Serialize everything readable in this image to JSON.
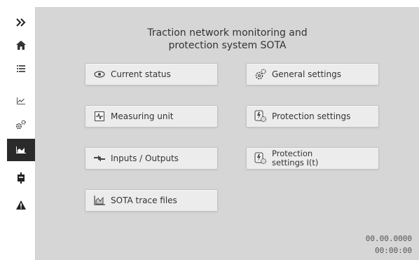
{
  "app": {
    "title_line1": "Traction network monitoring and",
    "title_line2": "protection system SOTA"
  },
  "sidebar": {
    "items": [
      {
        "icon": "expand-chevrons-icon"
      },
      {
        "icon": "home-icon"
      },
      {
        "icon": "list-icon"
      },
      {
        "icon": "line-chart-icon"
      },
      {
        "icon": "gears-icon"
      },
      {
        "icon": "area-chart-icon",
        "active": true
      },
      {
        "icon": "device-icon"
      },
      {
        "icon": "warning-icon"
      }
    ]
  },
  "menu": {
    "current_status": "Current status",
    "general_settings": "General settings",
    "measuring_unit": "Measuring unit",
    "protection_settings": "Protection settings",
    "inputs_outputs": "Inputs / Outputs",
    "protection_settings_it_line1": "Protection",
    "protection_settings_it_line2": "settings I(t)",
    "sota_trace_files": "SOTA trace files"
  },
  "status": {
    "date": "00.00.0000",
    "time": "00:00:00"
  },
  "colors": {
    "background": "#d6d6d6",
    "tile": "#ececec",
    "sidebar_active": "#2a2a2a"
  }
}
